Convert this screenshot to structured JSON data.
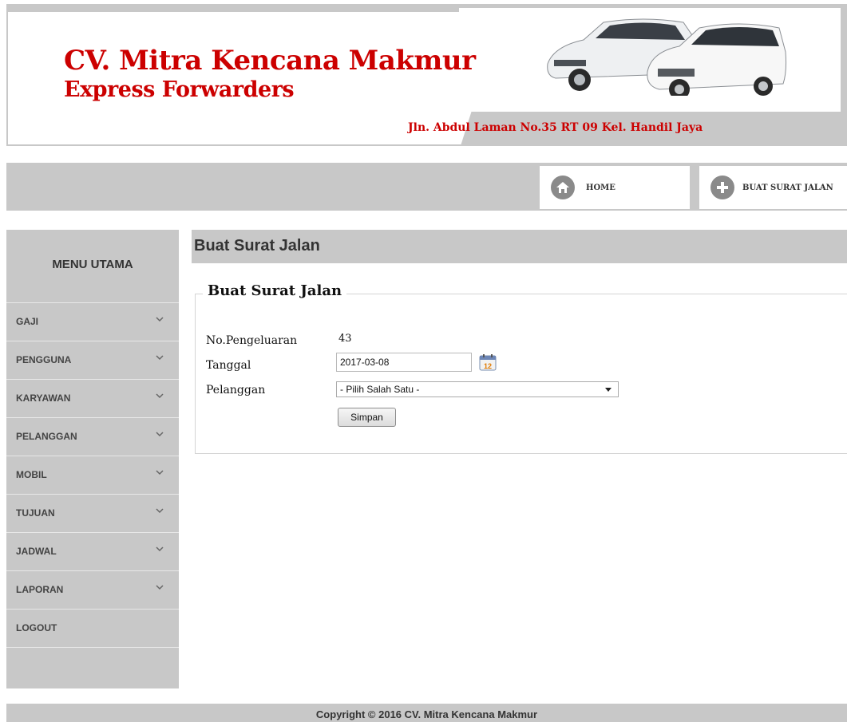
{
  "header": {
    "title_line1": "CV. Mitra Kencana Makmur",
    "title_line2": "Express Forwarders",
    "address": "Jln. Abdul Laman No.35 RT 09 Kel. Handil Jaya"
  },
  "nav": {
    "home": {
      "label": "HOME",
      "icon": "home-icon"
    },
    "create": {
      "label": "BUAT SURAT JALAN",
      "icon": "plus-icon"
    }
  },
  "sidebar": {
    "title": "MENU UTAMA",
    "items": [
      {
        "label": "GAJI",
        "has_submenu": true
      },
      {
        "label": "PENGGUNA",
        "has_submenu": true
      },
      {
        "label": "KARYAWAN",
        "has_submenu": true
      },
      {
        "label": "PELANGGAN",
        "has_submenu": true
      },
      {
        "label": "MOBIL",
        "has_submenu": true
      },
      {
        "label": "TUJUAN",
        "has_submenu": true
      },
      {
        "label": "JADWAL",
        "has_submenu": true
      },
      {
        "label": "LAPORAN",
        "has_submenu": true
      },
      {
        "label": "LOGOUT",
        "has_submenu": false
      }
    ]
  },
  "main": {
    "page_title": "Buat Surat Jalan",
    "form": {
      "legend": "Buat Surat Jalan",
      "no_label": "No.Pengeluaran",
      "no_value": "43",
      "date_label": "Tanggal",
      "date_value": "2017-03-08",
      "customer_label": "Pelanggan",
      "customer_selected": "- Pilih Salah Satu -",
      "submit_label": "Simpan"
    }
  },
  "footer": {
    "copyright": "Copyright © 2016 CV. Mitra Kencana Makmur"
  },
  "colors": {
    "brand_red": "#cc0000",
    "panel_gray": "#c8c8c8"
  }
}
